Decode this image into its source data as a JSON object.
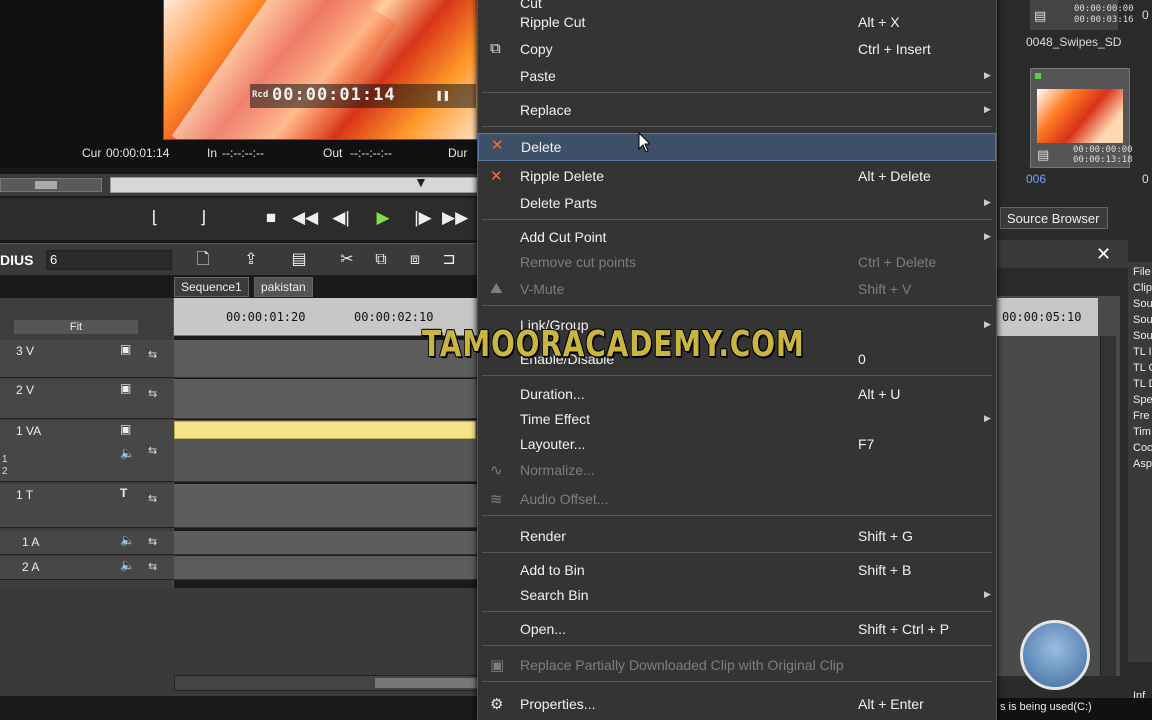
{
  "preview": {
    "rcd_label": "Rcd",
    "rcd_timecode": "00:00:01:14",
    "cur_label": "Cur",
    "cur_value": "00:00:01:14",
    "in_label": "In",
    "in_value": "--:--:--:--",
    "out_label": "Out",
    "out_value": "--:--:--:--",
    "dur_label": "Dur"
  },
  "timeline": {
    "app_name": "DIUS",
    "app_version": "6",
    "fit_label": "Fit",
    "tabs": [
      "Sequence1",
      "pakistan"
    ],
    "ruler": [
      "00:00:01:20",
      "00:00:02:10",
      "00:00:05:10"
    ],
    "tracks": [
      "3 V",
      "2 V",
      "1 VA",
      "1 T",
      "1 A",
      "2 A"
    ],
    "va_subs": [
      "1",
      "2"
    ]
  },
  "source_browser": {
    "tab_label": "Source Browser",
    "clip1_time_a": "00:00:00:00",
    "clip1_time_b": "00:00:03:16",
    "clip1_name": "0048_Swipes_SD",
    "clip2_time_a": "00:00:00:00",
    "clip2_time_b": "00:00:13:18",
    "clip2_name": "006",
    "edge_digits": [
      "0",
      "0"
    ],
    "side_items": [
      "File",
      "Clip",
      "Sou",
      "Sou",
      "Sou",
      "TL I",
      "TL C",
      "TL D",
      "Spe",
      "Fre",
      "Tim",
      "Coc",
      "Asp"
    ],
    "info_label": "Inf",
    "status_text": "s is being used(C:)"
  },
  "menu": {
    "items": [
      {
        "label": "Cut",
        "shortcut": "",
        "disabled": false
      },
      {
        "label": "Ripple Cut",
        "shortcut": "Alt + X",
        "disabled": false
      },
      {
        "label": "Copy",
        "shortcut": "Ctrl + Insert",
        "disabled": false
      },
      {
        "label": "Paste",
        "shortcut": "",
        "disabled": false
      },
      {
        "label": "Replace",
        "shortcut": "",
        "disabled": false
      },
      {
        "label": "Delete",
        "shortcut": "",
        "disabled": false
      },
      {
        "label": "Ripple Delete",
        "shortcut": "Alt + Delete",
        "disabled": false
      },
      {
        "label": "Delete Parts",
        "shortcut": "",
        "disabled": false
      },
      {
        "label": "Add Cut Point",
        "shortcut": "",
        "disabled": false
      },
      {
        "label": "Remove cut points",
        "shortcut": "Ctrl + Delete",
        "disabled": true
      },
      {
        "label": "V-Mute",
        "shortcut": "Shift + V",
        "disabled": true
      },
      {
        "label": "Link/Group",
        "shortcut": "",
        "disabled": false
      },
      {
        "label": "Enable/Disable",
        "shortcut": "0",
        "disabled": false
      },
      {
        "label": "Duration...",
        "shortcut": "Alt + U",
        "disabled": false
      },
      {
        "label": "Time Effect",
        "shortcut": "",
        "disabled": false
      },
      {
        "label": "Layouter...",
        "shortcut": "F7",
        "disabled": false
      },
      {
        "label": "Normalize...",
        "shortcut": "",
        "disabled": true
      },
      {
        "label": "Audio Offset...",
        "shortcut": "",
        "disabled": true
      },
      {
        "label": "Render",
        "shortcut": "Shift + G",
        "disabled": false
      },
      {
        "label": "Add to Bin",
        "shortcut": "Shift + B",
        "disabled": false
      },
      {
        "label": "Search Bin",
        "shortcut": "",
        "disabled": false
      },
      {
        "label": "Open...",
        "shortcut": "Shift + Ctrl + P",
        "disabled": false
      },
      {
        "label": "Replace Partially Downloaded Clip with Original Clip",
        "shortcut": "",
        "disabled": true
      },
      {
        "label": "Properties...",
        "shortcut": "Alt + Enter",
        "disabled": false
      }
    ]
  },
  "watermark": "TAMOORACADEMY.COM"
}
